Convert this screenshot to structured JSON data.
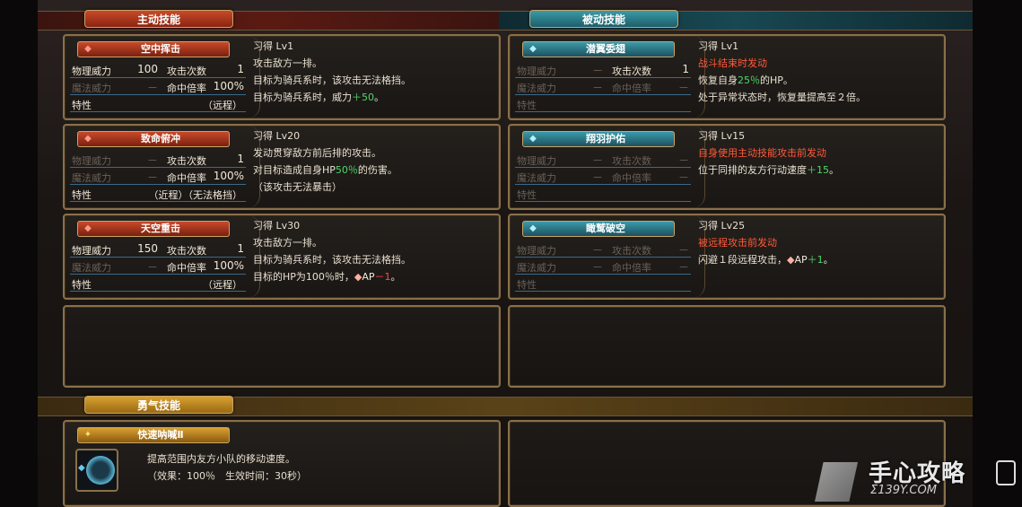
{
  "sections": {
    "active": "主动技能",
    "passive": "被动技能",
    "courage": "勇气技能"
  },
  "labels": {
    "phys": "物理威力",
    "magic": "魔法威力",
    "hits": "攻击次数",
    "acc": "命中倍率",
    "trait": "特性",
    "dash": "－"
  },
  "active_skills": [
    {
      "name": "空中挥击",
      "phys": "100",
      "hits": "1",
      "magic": "－",
      "acc": "100%",
      "trait": "（远程）",
      "learn": "习得 Lv1",
      "desc": [
        "攻击敌方一排。",
        "目标为骑兵系时，该攻击无法格挡。"
      ],
      "d3_pre": "目标为骑兵系时，威力",
      "d3_val": "＋50",
      "d3_post": "。"
    },
    {
      "name": "致命俯冲",
      "phys": "－",
      "hits": "1",
      "magic": "－",
      "acc": "100%",
      "trait": "（近程）（无法格挡）",
      "learn": "习得 Lv20",
      "d1": "发动贯穿敌方前后排的攻击。",
      "d2_pre": "对目标造成自身HP",
      "d2_val": "50％",
      "d2_post": "的伤害。",
      "d3": "（该攻击无法暴击）"
    },
    {
      "name": "天空重击",
      "phys": "150",
      "hits": "1",
      "magic": "－",
      "acc": "100%",
      "trait": "（远程）",
      "learn": "习得 Lv30",
      "desc": [
        "攻击敌方一排。",
        "目标为骑兵系时，该攻击无法格挡。"
      ],
      "d3_pre": "目标的HP为100％时，",
      "d3_ap": "AP",
      "d3_val": "－1",
      "d3_post": "。"
    }
  ],
  "passive_skills": [
    {
      "name": "潜翼委翅",
      "hits": "1",
      "learn": "习得 Lv1",
      "trigger": "战斗结束时发动",
      "d2_pre": "恢复自身",
      "d2_val": "25％",
      "d2_post": "的HP。",
      "d3": "处于异常状态时，恢复量提高至２倍。"
    },
    {
      "name": "翔羽护佑",
      "learn": "习得 Lv15",
      "trigger": "自身使用主动技能攻击前发动",
      "d2_pre": "位于同排的友方行动速度",
      "d2_val": "＋15",
      "d2_post": "。"
    },
    {
      "name": "瞰鹫破空",
      "learn": "习得 Lv25",
      "trigger": "被远程攻击前发动",
      "d2_pre": "闪避１段远程攻击，",
      "d2_ap": "AP",
      "d2_val": "＋1",
      "d2_post": "。"
    }
  ],
  "courage_skill": {
    "name": "快速呐喊Ⅱ",
    "desc1": "提高范围内友方小队的移动速度。",
    "desc2": "（效果：100％　生效时间：30秒）"
  },
  "watermark": {
    "text": "手心攻略",
    "url": "Σ139Y.COM"
  },
  "icons": {
    "active_gem": "red-diamond-icon",
    "passive_gem": "teal-diamond-icon",
    "courage_gem": "gold-feather-icon"
  }
}
